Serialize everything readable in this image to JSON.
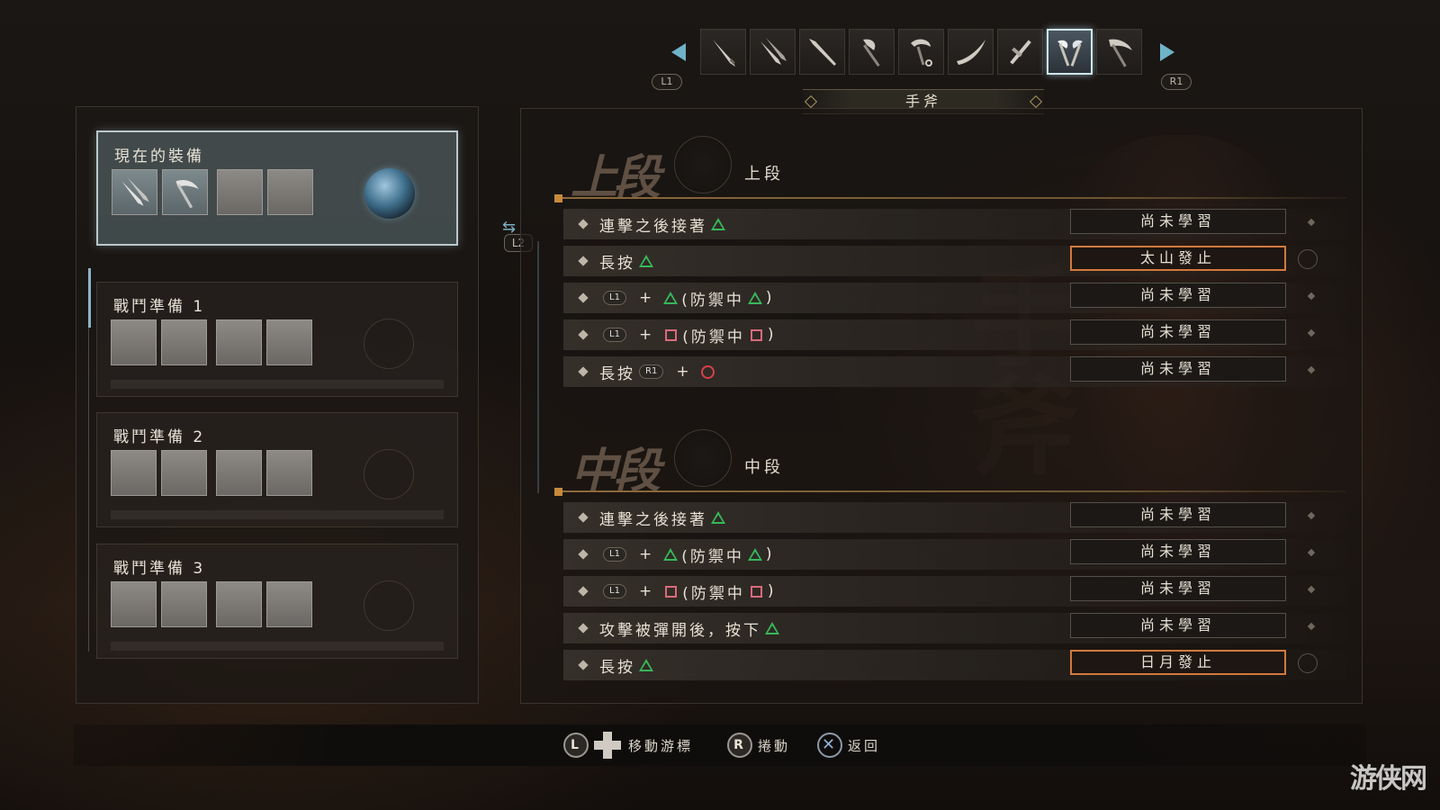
{
  "weapon_bar": {
    "left_bumper": "L1",
    "right_bumper": "R1",
    "weapons": [
      {
        "icon": "katana-icon",
        "selected": false
      },
      {
        "icon": "dual-swords-icon",
        "selected": false
      },
      {
        "icon": "spear-icon",
        "selected": false
      },
      {
        "icon": "axe-icon",
        "selected": false
      },
      {
        "icon": "kusarigama-icon",
        "selected": false
      },
      {
        "icon": "odachi-icon",
        "selected": false
      },
      {
        "icon": "tonfa-icon",
        "selected": false
      },
      {
        "icon": "hatchets-icon",
        "selected": true
      },
      {
        "icon": "switchglaive-icon",
        "selected": false
      }
    ],
    "selected_weapon_name": "手斧"
  },
  "left_panel": {
    "current": {
      "title": "現在的裝備"
    },
    "loadouts": [
      {
        "title": "戰鬥準備 1"
      },
      {
        "title": "戰鬥準備 2"
      },
      {
        "title": "戰鬥準備 3"
      }
    ]
  },
  "switch_button": "L2",
  "stances": [
    {
      "kanji": "上段",
      "label": "上段",
      "moves": [
        {
          "prefix": "連擊之後接著",
          "status": "尚未學習"
        },
        {
          "prefix": "長按",
          "status": "太山發止"
        },
        {
          "guard": "(防禦中",
          "close": ")",
          "status": "尚未學習"
        },
        {
          "guard": "(防禦中",
          "close": ")",
          "status": "尚未學習"
        },
        {
          "prefix": "長按",
          "status": "尚未學習"
        }
      ]
    },
    {
      "kanji": "中段",
      "label": "中段",
      "moves": [
        {
          "prefix": "連擊之後接著",
          "status": "尚未學習"
        },
        {
          "guard": "(防禦中",
          "close": ")",
          "status": "尚未學習"
        },
        {
          "guard": "(防禦中",
          "close": ")",
          "status": "尚未學習"
        },
        {
          "prefix": "攻擊被彈開後，按下",
          "status": "尚未學習"
        },
        {
          "prefix": "長按",
          "status": "日月發止"
        }
      ]
    }
  ],
  "button_labels": {
    "l1": "L1",
    "r1": "R1",
    "plus": "+"
  },
  "hints": {
    "move": {
      "stick": "L",
      "label": "移動游標"
    },
    "scroll": {
      "stick": "R",
      "label": "捲動"
    },
    "back": {
      "label": "返回"
    }
  },
  "watermarks": {
    "weapon": "手斧",
    "site": "游侠网"
  },
  "colors": {
    "triangle": "#37b75a",
    "square": "#d86b7b",
    "circle": "#d8404b",
    "learned_border": "#d2793d",
    "accent": "#6fb3c8"
  }
}
